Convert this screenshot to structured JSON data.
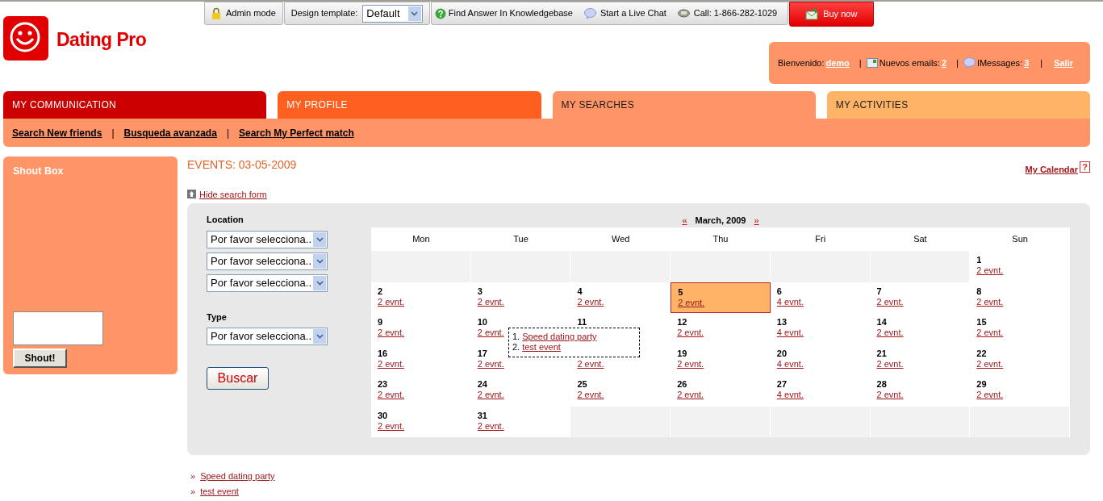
{
  "logo": {
    "text": "Dating Pro"
  },
  "toolbar": {
    "admin_mode": "Admin mode",
    "design_template_label": "Design template:",
    "design_template_value": "Default",
    "knowledgebase": "Find Answer In Knowledgebase",
    "live_chat": "Start a Live Chat",
    "call": "Call: 1-866-282-1029",
    "buy_now": "Buy now"
  },
  "welcome": {
    "greeting": "Bienvenido:",
    "user": "demo",
    "separators": [
      "|",
      "|",
      "|"
    ],
    "emails_label": "Nuevos emails:",
    "emails_count": "2",
    "imessages_label": "IMessages:",
    "imessages_count": "3",
    "logout": "Salir"
  },
  "tabs": [
    {
      "label": "MY COMMUNICATION",
      "selected": false,
      "color": "#cc0000"
    },
    {
      "label": "MY PROFILE",
      "selected": false,
      "color": "#ff5f1f"
    },
    {
      "label": "MY SEARCHES",
      "selected": true,
      "color": "#ff9466"
    },
    {
      "label": "MY ACTIVITIES",
      "selected": false,
      "color": "#ffb366"
    }
  ],
  "subnav": [
    {
      "kind": "link",
      "text": "Search New friends"
    },
    {
      "kind": "separator",
      "text": "|"
    },
    {
      "kind": "link",
      "text": "Busqueda avanzada"
    },
    {
      "kind": "separator",
      "text": "|"
    },
    {
      "kind": "link",
      "text": "Search My Perfect match"
    }
  ],
  "shout_box": {
    "title": "Shout Box",
    "button": "Shout!"
  },
  "page_title": "EVENTS: 03-05-2009",
  "my_calendar": "My Calendar",
  "help": "?",
  "hide_search_form": "Hide search form",
  "search_form": {
    "location_label": "Location",
    "location_selects": [
      "Por favor selecciona..",
      "Por favor selecciona..",
      "Por favor selecciona.."
    ],
    "type_label": "Type",
    "type_select": "Por favor selecciona..",
    "button": "Buscar"
  },
  "calendar": {
    "prev": "«",
    "month": "March, 2009",
    "next": "»",
    "weekdays": [
      "Mon",
      "Tue",
      "Wed",
      "Thu",
      "Fri",
      "Sat",
      "Sun"
    ],
    "weeks": [
      [
        {
          "kind": "blank"
        },
        {
          "kind": "blank"
        },
        {
          "kind": "blank"
        },
        {
          "kind": "blank"
        },
        {
          "kind": "blank"
        },
        {
          "kind": "blank"
        },
        {
          "day": "1",
          "events": "2 evnt.",
          "selected": false
        }
      ],
      [
        {
          "day": "2",
          "events": "2 evnt.",
          "selected": false
        },
        {
          "day": "3",
          "events": "2 evnt.",
          "selected": false
        },
        {
          "day": "4",
          "events": "2 evnt.",
          "selected": false
        },
        {
          "day": "5",
          "events": "2 evnt.",
          "selected": true
        },
        {
          "day": "6",
          "events": "4 evnt.",
          "selected": false
        },
        {
          "day": "7",
          "events": "2 evnt.",
          "selected": false
        },
        {
          "day": "8",
          "events": "2 evnt.",
          "selected": false
        }
      ],
      [
        {
          "day": "9",
          "events": "2 evnt.",
          "selected": false
        },
        {
          "day": "10",
          "events": "2 evnt.",
          "selected": false
        },
        {
          "day": "11",
          "selected": false
        },
        {
          "day": "12",
          "events": "2 evnt.",
          "selected": false
        },
        {
          "day": "13",
          "events": "4 evnt.",
          "selected": false
        },
        {
          "day": "14",
          "events": "2 evnt.",
          "selected": false
        },
        {
          "day": "15",
          "events": "2 evnt.",
          "selected": false
        }
      ],
      [
        {
          "day": "16",
          "events": "2 evnt.",
          "selected": false
        },
        {
          "day": "17",
          "events": "2 evnt.",
          "selected": false
        },
        {
          "events": "2 evnt.",
          "selected": false
        },
        {
          "day": "19",
          "events": "2 evnt.",
          "selected": false
        },
        {
          "day": "20",
          "events": "4 evnt.",
          "selected": false
        },
        {
          "day": "21",
          "events": "2 evnt.",
          "selected": false
        },
        {
          "day": "22",
          "events": "2 evnt.",
          "selected": false
        }
      ],
      [
        {
          "day": "23",
          "events": "2 evnt.",
          "selected": false
        },
        {
          "day": "24",
          "events": "2 evnt.",
          "selected": false
        },
        {
          "day": "25",
          "events": "2 evnt.",
          "selected": false
        },
        {
          "day": "26",
          "events": "2 evnt.",
          "selected": false
        },
        {
          "day": "27",
          "events": "4 evnt.",
          "selected": false
        },
        {
          "day": "28",
          "events": "2 evnt.",
          "selected": false
        },
        {
          "day": "29",
          "events": "2 evnt.",
          "selected": false
        }
      ],
      [
        {
          "day": "30",
          "events": "2 evnt.",
          "selected": false
        },
        {
          "day": "31",
          "events": "2 evnt.",
          "selected": false
        },
        {
          "kind": "blank"
        },
        {
          "kind": "blank"
        },
        {
          "kind": "blank"
        },
        {
          "kind": "blank"
        },
        {
          "kind": "blank"
        }
      ]
    ],
    "popup": [
      {
        "number": "1.",
        "title": "Speed dating party"
      },
      {
        "number": "2.",
        "title": "test event"
      }
    ]
  },
  "event_list": [
    {
      "bullet": "»",
      "title": "Speed dating party"
    },
    {
      "bullet": "»",
      "title": "test event"
    }
  ]
}
